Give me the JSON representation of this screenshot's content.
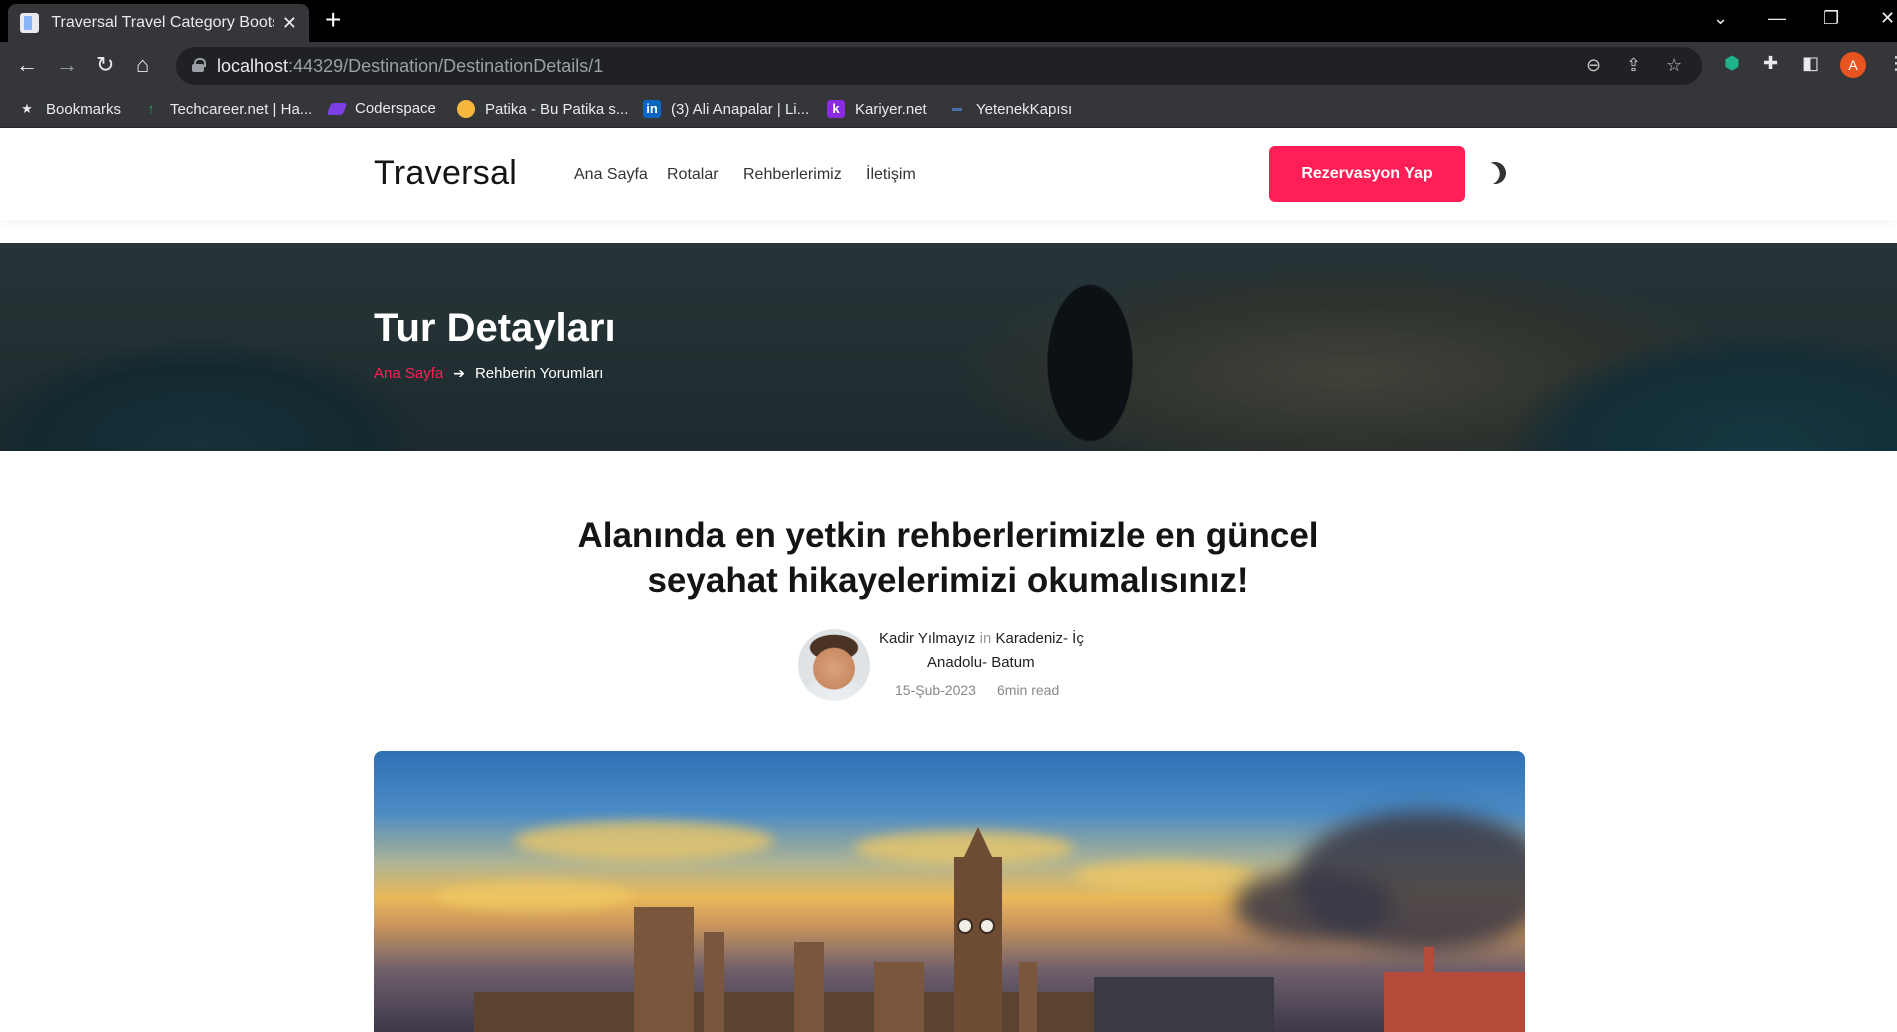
{
  "browser": {
    "tab_title": "Traversal Travel Category Bootstr",
    "url_host": "localhost",
    "url_path": ":44329/Destination/DestinationDetails/1",
    "profile_initial": "A",
    "bookmarks": [
      {
        "label": "Bookmarks",
        "icon": "star-icon"
      },
      {
        "label": "Techcareer.net | Ha...",
        "icon": "techcareer-icon"
      },
      {
        "label": "Coderspace",
        "icon": "coderspace-icon"
      },
      {
        "label": "Patika - Bu Patika s...",
        "icon": "patika-icon"
      },
      {
        "label": "(3) Ali Anapalar | Li...",
        "icon": "linkedin-icon"
      },
      {
        "label": "Kariyer.net",
        "icon": "kariyer-icon"
      },
      {
        "label": "YetenekKapısı",
        "icon": "yetenekkapisi-icon"
      }
    ]
  },
  "site": {
    "logo": "Traversal",
    "nav": [
      "Ana Sayfa",
      "Rotalar",
      "Rehberlerimiz",
      "İletişim"
    ],
    "cta": "Rezervasyon Yap",
    "accent": "#ff1e56"
  },
  "hero": {
    "title": "Tur Detayları",
    "crumb_home": "Ana Sayfa",
    "crumb_current": "Rehberin Yorumları"
  },
  "article": {
    "headline_1": "Alanında en yetkin rehberlerimizle en güncel",
    "headline_2": "seyahat hikayelerimizi okumalısınız!",
    "author": "Kadir Yılmayız",
    "in_word": "in",
    "category_1": "Karadeniz- İç",
    "category_2": "Anadolu- Batum",
    "date": "15-Şub-2023",
    "read_time": "6min read"
  }
}
